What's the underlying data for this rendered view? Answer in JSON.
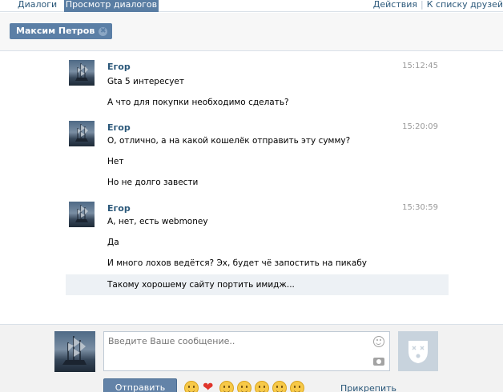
{
  "tabs": {
    "dialogs": "Диалоги",
    "view": "Просмотр диалогов"
  },
  "top_actions": {
    "actions": "Действия",
    "separator": "|",
    "friends": "К списку друзей"
  },
  "peer": {
    "name": "Максим Петров",
    "remove": "✖"
  },
  "messages": [
    {
      "sender": "Егор",
      "time": "15:12:45",
      "lines": [
        "Gta 5 интересует",
        "А что для покупки необходимо сделать?"
      ]
    },
    {
      "sender": "Егор",
      "time": "15:20:09",
      "lines": [
        "О, отлично, а на какой кошелёк отправить эту сумму?",
        "Нет",
        "Но не долго завести"
      ]
    },
    {
      "sender": "Егор",
      "time": "15:30:59",
      "lines": [
        "А, нет, есть webmoney",
        "Да",
        "И много лохов ведётся? Эх, будет чё запостить на пикабу",
        "Такому хорошему сайту портить имидж..."
      ]
    }
  ],
  "composer": {
    "placeholder": "Введите Ваше сообщение..",
    "send_label": "Отправить",
    "pin_label": "Прикрепить"
  },
  "colors": {
    "accent": "#597da3",
    "link": "#2b587a",
    "highlight": "#edf1f5"
  }
}
